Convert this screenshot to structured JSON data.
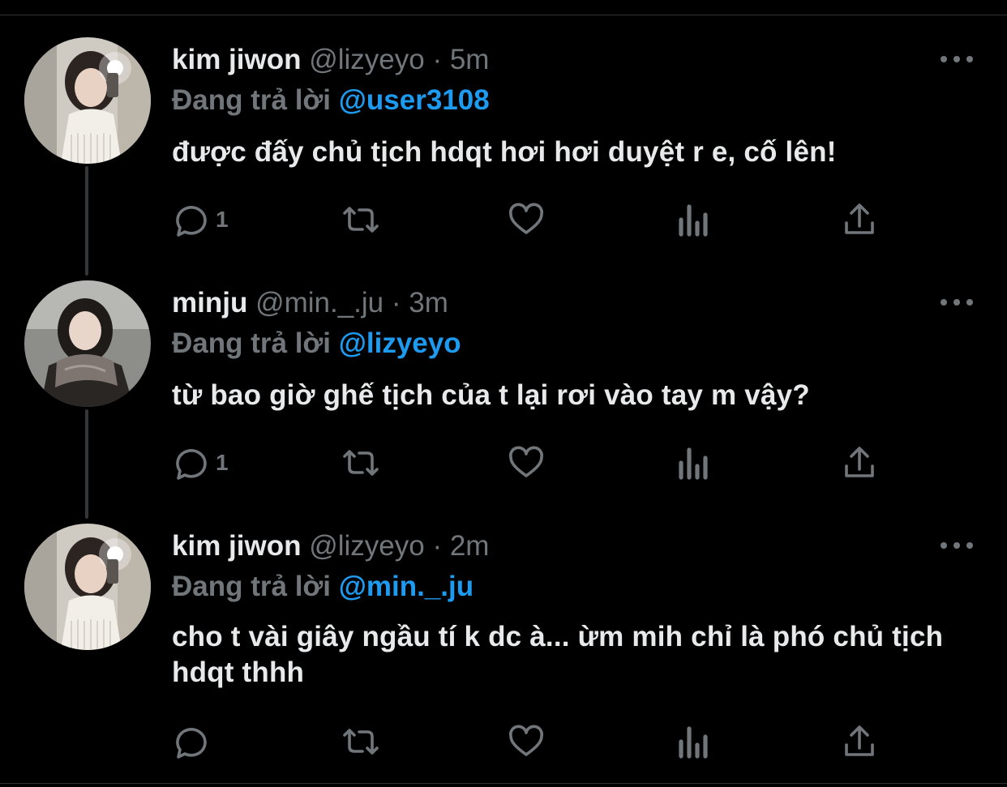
{
  "colors": {
    "background": "#000000",
    "text": "#e7e9ea",
    "muted": "#71767b",
    "mention": "#1d9bf0"
  },
  "tweets": [
    {
      "name": "kim jiwon",
      "handle": "@lizyeyo",
      "separator": "·",
      "time": "5m",
      "reply_prefix": "Đang trả lời",
      "reply_to": "@user3108",
      "text": "được đấy chủ tịch hdqt hơi hơi duyệt r e, cố lên!",
      "reply_count": "1",
      "avatar": "avatar-photo"
    },
    {
      "name": "minju",
      "handle": "@min._.ju",
      "separator": "·",
      "time": "3m",
      "reply_prefix": "Đang trả lời",
      "reply_to": "@lizyeyo",
      "text": "từ bao giờ ghế tịch của t lại rơi vào tay m vậy?",
      "reply_count": "1",
      "avatar": "avatar-photo"
    },
    {
      "name": "kim jiwon",
      "handle": "@lizyeyo",
      "separator": "·",
      "time": "2m",
      "reply_prefix": "Đang trả lời",
      "reply_to": "@min._.ju",
      "text": "cho t vài giây ngầu tí k dc à... ừm mih chỉ là phó chủ tịch hdqt thhh",
      "reply_count": "",
      "avatar": "avatar-photo"
    }
  ],
  "icons": [
    "reply-icon",
    "retweet-icon",
    "like-icon",
    "views-icon",
    "share-icon",
    "more-icon"
  ]
}
